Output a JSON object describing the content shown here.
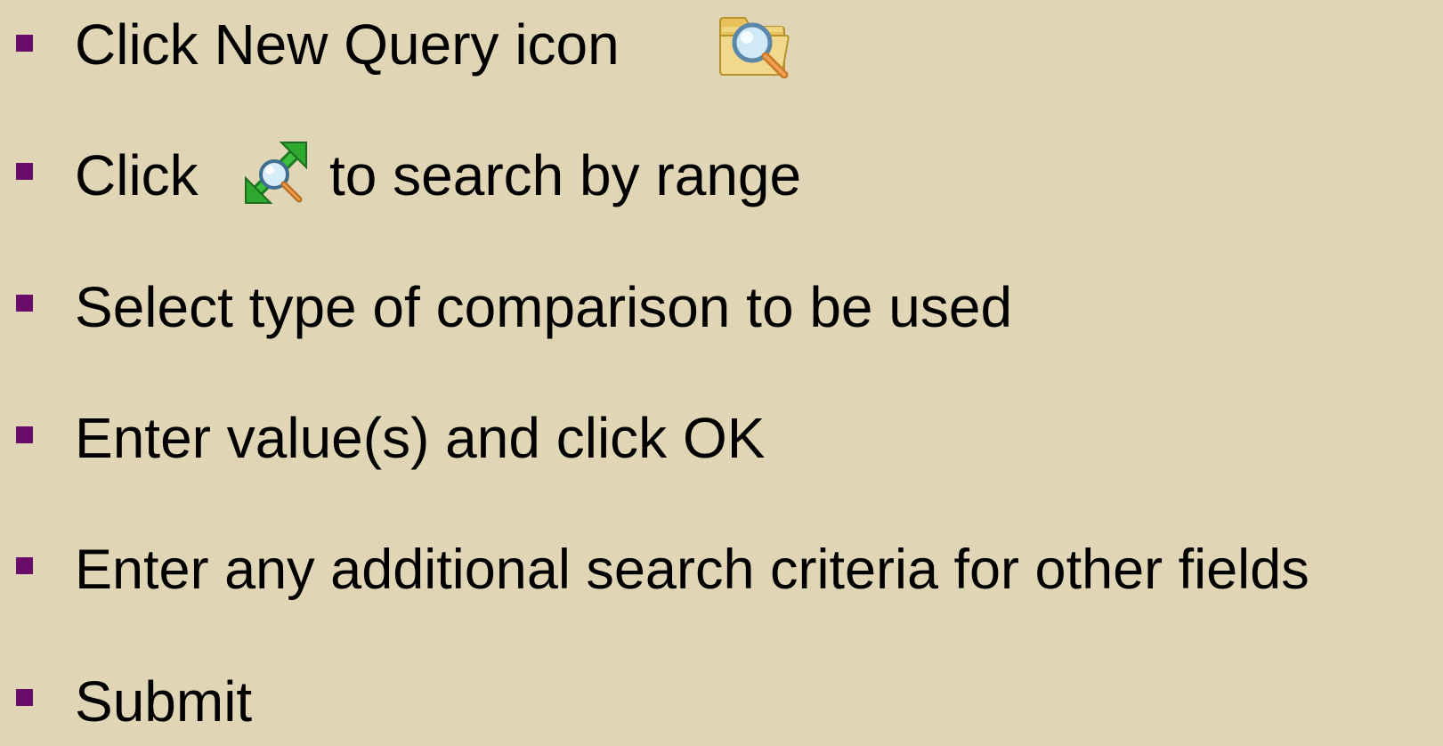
{
  "bullets": [
    {
      "text": "Click New Query icon",
      "icon": "new-query-folder-magnifier-icon"
    },
    {
      "text_before": "Click",
      "icon": "range-search-arrow-magnifier-icon",
      "text_after": "to search by range"
    },
    {
      "text": "Select type of comparison to be used"
    },
    {
      "text": "Enter value(s) and click OK"
    },
    {
      "text": "Enter any additional search criteria for other fields"
    },
    {
      "text": "Submit"
    }
  ],
  "colors": {
    "background": "#e0d5b5",
    "bullet": "#6a0d6a",
    "text": "#000000"
  }
}
